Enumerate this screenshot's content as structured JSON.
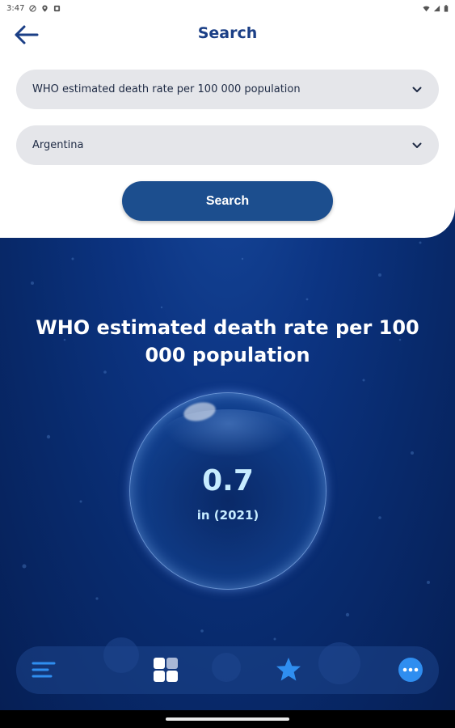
{
  "status_bar": {
    "time": "3:47",
    "icons": [
      "do-not-disturb-icon",
      "location-icon",
      "notification-icon",
      "wifi-icon",
      "signal-icon",
      "battery-icon"
    ]
  },
  "header": {
    "title": "Search",
    "back_icon": "arrow-left-icon"
  },
  "filters": {
    "indicator": "WHO estimated death rate per 100 000 population",
    "country": "Argentina"
  },
  "search_button": {
    "label": "Search"
  },
  "result": {
    "title": "WHO estimated death rate per 100 000 population",
    "value": "0.7",
    "year_label": "in (2021)"
  },
  "bottom_nav": {
    "items": [
      {
        "icon": "menu-lines-icon"
      },
      {
        "icon": "grid-icon"
      },
      {
        "icon": "star-icon"
      },
      {
        "icon": "more-dots-icon"
      }
    ]
  },
  "colors": {
    "title": "#1b3f86",
    "button": "#1c4e8e",
    "dropdown_bg": "#e5e6ea",
    "value": "#c7ecff",
    "nav_accent": "#2f8ef0"
  }
}
